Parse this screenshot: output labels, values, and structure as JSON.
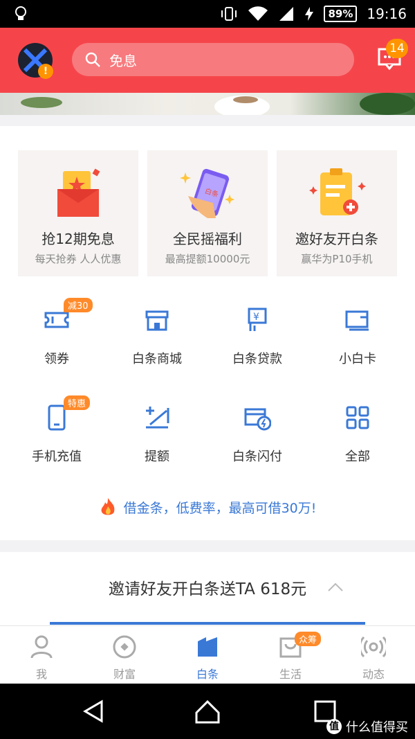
{
  "status_bar": {
    "battery": "89%",
    "time": "19:16"
  },
  "header": {
    "search_placeholder": "免息",
    "message_count": "14"
  },
  "promos": [
    {
      "title": "抢12期免息",
      "subtitle": "每天抢券 人人优惠"
    },
    {
      "title": "全民摇福利",
      "subtitle": "最高提额10000元",
      "badge": "白条"
    },
    {
      "title": "邀好友开白条",
      "subtitle": "赢华为P10手机"
    }
  ],
  "grid": [
    {
      "label": "领券",
      "tag": "减30"
    },
    {
      "label": "白条商城"
    },
    {
      "label": "白条贷款"
    },
    {
      "label": "小白卡"
    },
    {
      "label": "手机充值",
      "tag": "特惠"
    },
    {
      "label": "提额"
    },
    {
      "label": "白条闪付"
    },
    {
      "label": "全部"
    }
  ],
  "loan_banner": "借金条，低费率，最高可借30万!",
  "invite": {
    "title": "邀请好友开白条送TA 618元"
  },
  "tabs": [
    {
      "label": "我"
    },
    {
      "label": "财富"
    },
    {
      "label": "白条",
      "active": true
    },
    {
      "label": "生活",
      "badge": "众筹"
    },
    {
      "label": "动态"
    }
  ],
  "watermark": "什么值得买",
  "colors": {
    "header": "#f5454b",
    "accent": "#3a78d6",
    "badge": "#ff8a2a"
  }
}
